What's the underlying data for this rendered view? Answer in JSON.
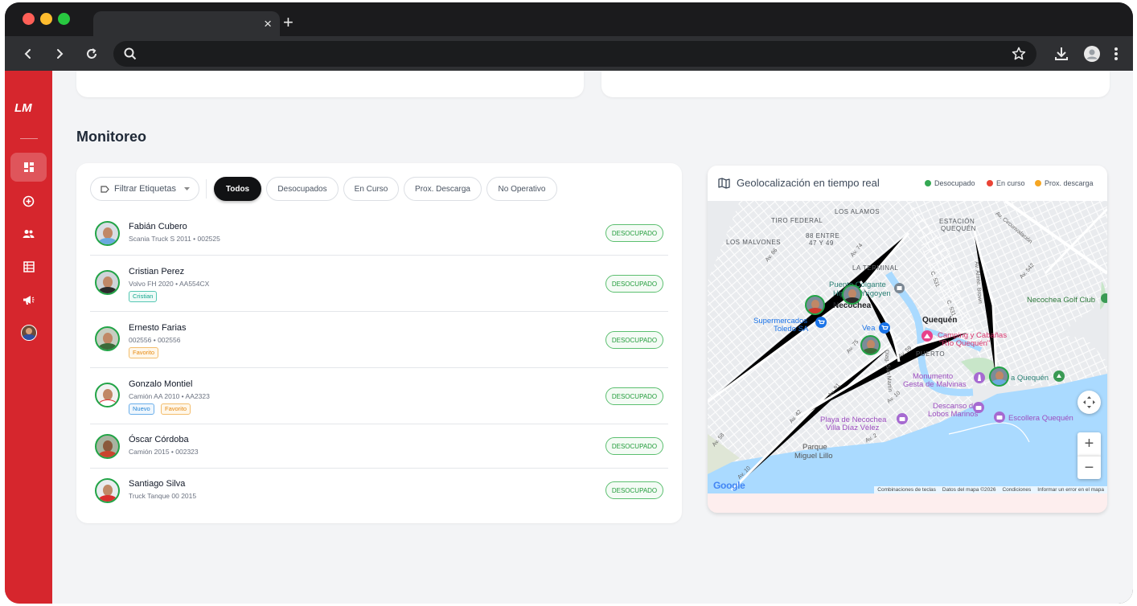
{
  "browser": {
    "traffic_colors": [
      "#ff5f57",
      "#febc2e",
      "#28c840"
    ],
    "tab_close": "×",
    "new_tab": "+",
    "address": ""
  },
  "sidebar": {
    "logo": "LM",
    "brand_color": "#d6262d",
    "items": [
      {
        "name": "dashboard-icon",
        "active": true
      },
      {
        "name": "add-circle-icon",
        "active": false
      },
      {
        "name": "users-icon",
        "active": false
      },
      {
        "name": "table-icon",
        "active": false
      },
      {
        "name": "megaphone-icon",
        "active": false
      },
      {
        "name": "user-avatar",
        "active": false
      }
    ]
  },
  "main": {
    "section_title": "Monitoreo",
    "filter_label": "Filtrar Etiquetas",
    "chips": [
      "Todos",
      "Desocupados",
      "En Curso",
      "Prox. Descarga",
      "No Operativo"
    ],
    "active_chip": "Todos",
    "drivers": [
      {
        "name": "Fabián Cubero",
        "vehicle": "Scania Truck S 2011 • 002525",
        "tags": [],
        "status": "DESOCUPADO"
      },
      {
        "name": "Cristian Perez",
        "vehicle": "Volvo FH 2020 • AA554CX",
        "tags": [
          {
            "label": "Cristian",
            "color": "teal"
          }
        ],
        "status": "DESOCUPADO"
      },
      {
        "name": "Ernesto Farias",
        "vehicle": "002556 • 002556",
        "tags": [
          {
            "label": "Favorito",
            "color": "orange"
          }
        ],
        "status": "DESOCUPADO"
      },
      {
        "name": "Gonzalo Montiel",
        "vehicle": "Camión AA 2010 • AA2323",
        "tags": [
          {
            "label": "Nuevo",
            "color": "blue"
          },
          {
            "label": "Favorito",
            "color": "orange"
          }
        ],
        "status": "DESOCUPADO"
      },
      {
        "name": "Óscar Córdoba",
        "vehicle": "Camión 2015 • 002323",
        "tags": [],
        "status": "DESOCUPADO"
      },
      {
        "name": "Santiago Silva",
        "vehicle": "Truck Tanque 00 2015",
        "tags": [],
        "status": "DESOCUPADO"
      }
    ]
  },
  "map_panel": {
    "title": "Geolocalización en tiempo real",
    "legend": [
      {
        "label": "Desocupado",
        "color": "#34a853"
      },
      {
        "label": "En curso",
        "color": "#ea4335"
      },
      {
        "label": "Prox. descarga",
        "color": "#f6a623"
      }
    ],
    "labels": {
      "los_alamos": "LOS ALAMOS",
      "tiro_federal": "TIRO FEDERAL",
      "estacion_1": "ESTACIÓN",
      "estacion_2": "QUEQUÉN",
      "los_malvones": "LOS MALVONES",
      "barrio_1": "88 ENTRE",
      "barrio_2": "47 Y 49",
      "la_terminal": "LA TERMINAL",
      "av_circunvalacion": "Av. Circunvalación",
      "av_74": "Av. 74",
      "av_86": "Av. 86",
      "av_542": "Av. 542",
      "c_531": "C. 531",
      "c_531b": "C. 531",
      "av_almte_brown": "Av. Almte. Brown",
      "puente_1": "Puente Colgante",
      "puente_2": "Hipólito Yrigoyen",
      "necochea": "Necochea",
      "quequen": "Quequén",
      "golf_club": "Necochea Golf Club",
      "super_1": "Supermercados",
      "super_2": "Toledo SA",
      "vea": "Vea",
      "camping_1": "Camping y Cabañas",
      "camping_2": "\"Río Quequén\"",
      "puerto": "PUERTO",
      "av_75": "Av. 75",
      "av_59": "Av. 59",
      "diag_san_martin": "Diag. San Martín",
      "monumento_1": "Monumento",
      "monumento_2": "Gesta de Malvinas",
      "a_quequen": "a Quequén",
      "av_91": "Av. 91",
      "av_10": "Av. 10",
      "av_42": "Av. 42",
      "descanso_1": "Descanso de",
      "descanso_2": "Lobos Marinos",
      "escollera": "Escollera Quequén",
      "playa_1": "Playa de Necochea",
      "playa_2": "Villa Díaz Vélez",
      "av_2": "Av. 2",
      "av_58": "Av. 58",
      "parque_1": "Parque",
      "parque_2": "Miguel Lillo",
      "av_10b": "Av. 10"
    },
    "google": "Google",
    "zoom_in": "+",
    "zoom_out": "−",
    "attribution": [
      "Combinaciones de teclas",
      "Datos del mapa ©2026",
      "Condiciones",
      "Informar un error en el mapa"
    ]
  }
}
